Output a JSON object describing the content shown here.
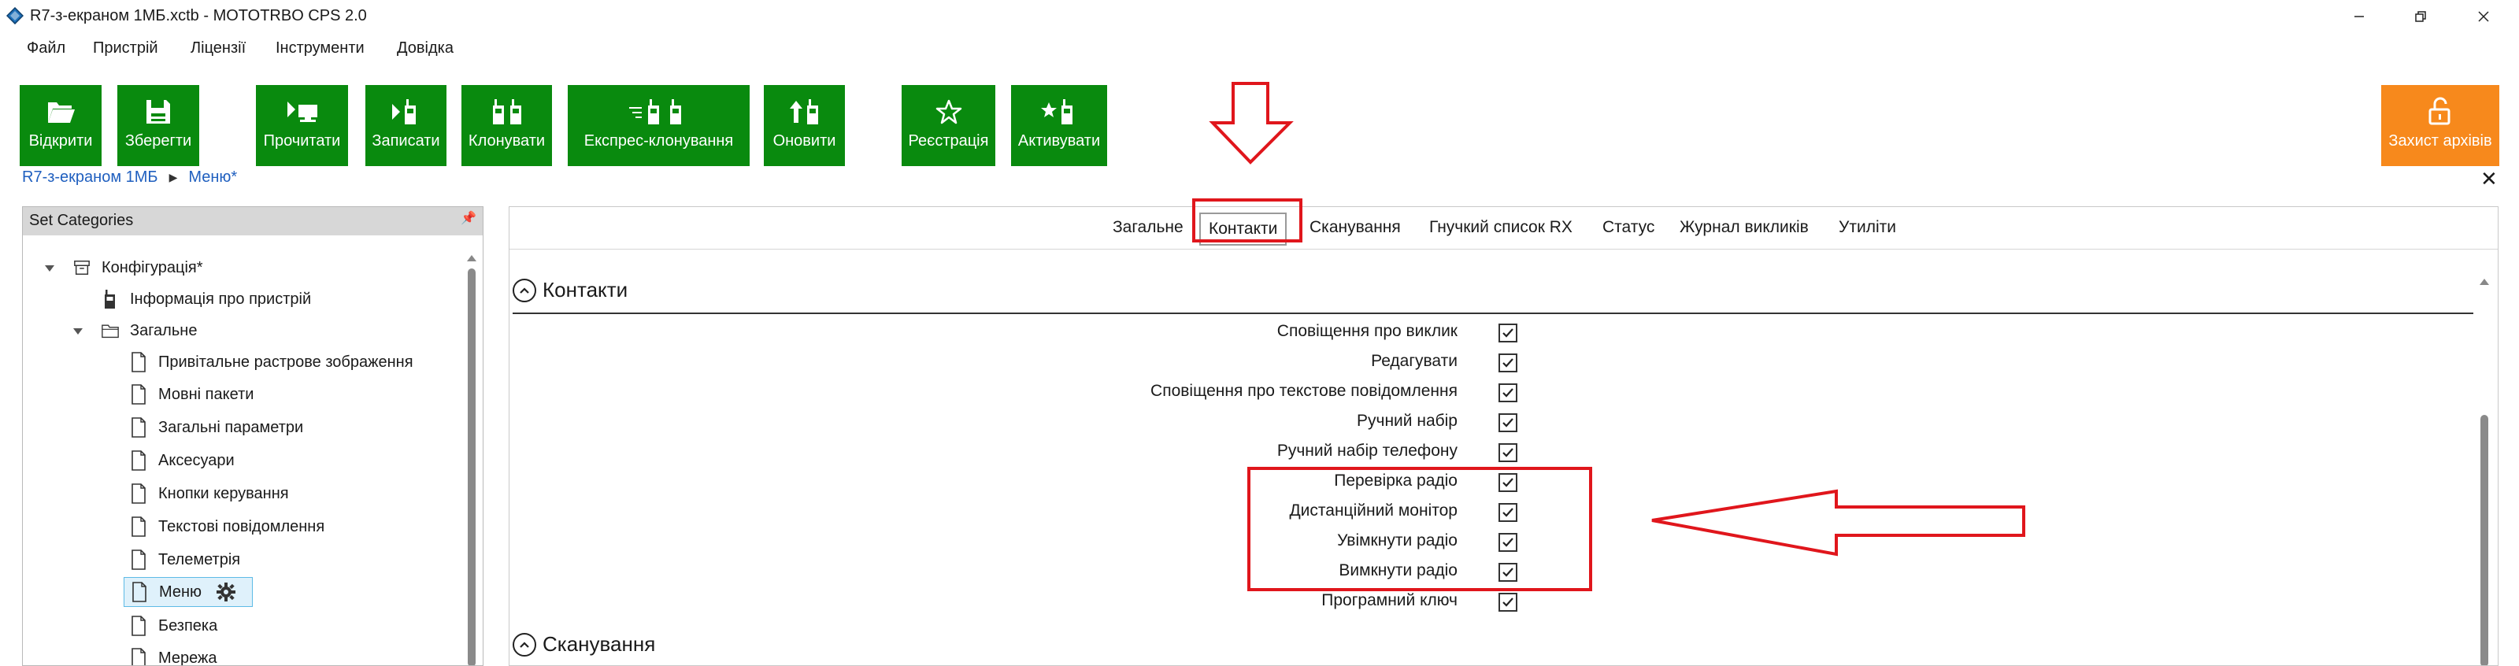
{
  "window": {
    "title": "R7-з-екраном 1МБ.xctb - MOTOTRBO CPS 2.0",
    "controls": {
      "minimize": "—",
      "maximize": "❐",
      "close": "✕"
    }
  },
  "menu": [
    "Файл",
    "Пристрій",
    "Ліцензії",
    "Інструменти",
    "Довідка"
  ],
  "toolbar": {
    "open": "Відкрити",
    "save": "Зберегти",
    "read": "Прочитати",
    "write": "Записати",
    "clone": "Клонувати",
    "express_clone": "Експрес-клонування",
    "update": "Оновити",
    "register": "Реєстрація",
    "activate": "Активувати",
    "archive_protect": "Захист архівів"
  },
  "breadcrumb": {
    "root": "R7-з-екраном 1МБ",
    "current": "Меню*"
  },
  "left_panel": {
    "header": "Set Categories",
    "tree": [
      {
        "label": "Конфігурація*",
        "level": 0,
        "icon": "archive-icon",
        "expanded": true
      },
      {
        "label": "Інформація про пристрій",
        "level": 1,
        "icon": "radio-device-icon"
      },
      {
        "label": "Загальне",
        "level": 1,
        "icon": "folder-icon",
        "expanded": true
      },
      {
        "label": "Привітальне растрове зображення",
        "level": 2,
        "icon": "document-icon"
      },
      {
        "label": "Мовні пакети",
        "level": 2,
        "icon": "document-icon"
      },
      {
        "label": "Загальні параметри",
        "level": 2,
        "icon": "document-icon"
      },
      {
        "label": "Аксесуари",
        "level": 2,
        "icon": "document-icon"
      },
      {
        "label": "Кнопки керування",
        "level": 2,
        "icon": "document-icon"
      },
      {
        "label": "Текстові повідомлення",
        "level": 2,
        "icon": "document-icon"
      },
      {
        "label": "Телеметрія",
        "level": 2,
        "icon": "document-icon"
      },
      {
        "label": "Меню",
        "level": 2,
        "icon": "document-icon",
        "selected": true
      },
      {
        "label": "Безпека",
        "level": 2,
        "icon": "document-icon"
      },
      {
        "label": "Мережа",
        "level": 2,
        "icon": "document-icon"
      }
    ]
  },
  "tabs": [
    "Загальне",
    "Контакти",
    "Сканування",
    "Гнучкий список RX",
    "Статус",
    "Журнал викликів",
    "Утиліти"
  ],
  "active_tab": "Контакти",
  "sections": {
    "contacts": "Контакти",
    "scan": "Сканування"
  },
  "contacts_props": [
    {
      "label": "Сповіщення про виклик",
      "checked": true
    },
    {
      "label": "Редагувати",
      "checked": true
    },
    {
      "label": "Сповіщення про текстове повідомлення",
      "checked": true
    },
    {
      "label": "Ручний набір",
      "checked": true
    },
    {
      "label": "Ручний набір телефону",
      "checked": true
    },
    {
      "label": "Перевірка радіо",
      "checked": true
    },
    {
      "label": "Дистанційний монітор",
      "checked": true
    },
    {
      "label": "Увімкнути радіо",
      "checked": true
    },
    {
      "label": "Вимкнути радіо",
      "checked": true
    },
    {
      "label": "Програмний ключ",
      "checked": true
    }
  ],
  "colors": {
    "toolbar_green": "#098a0e",
    "toolbar_orange": "#f7891c",
    "annotation_red": "#e0161c",
    "link_blue": "#1f5fbf"
  }
}
